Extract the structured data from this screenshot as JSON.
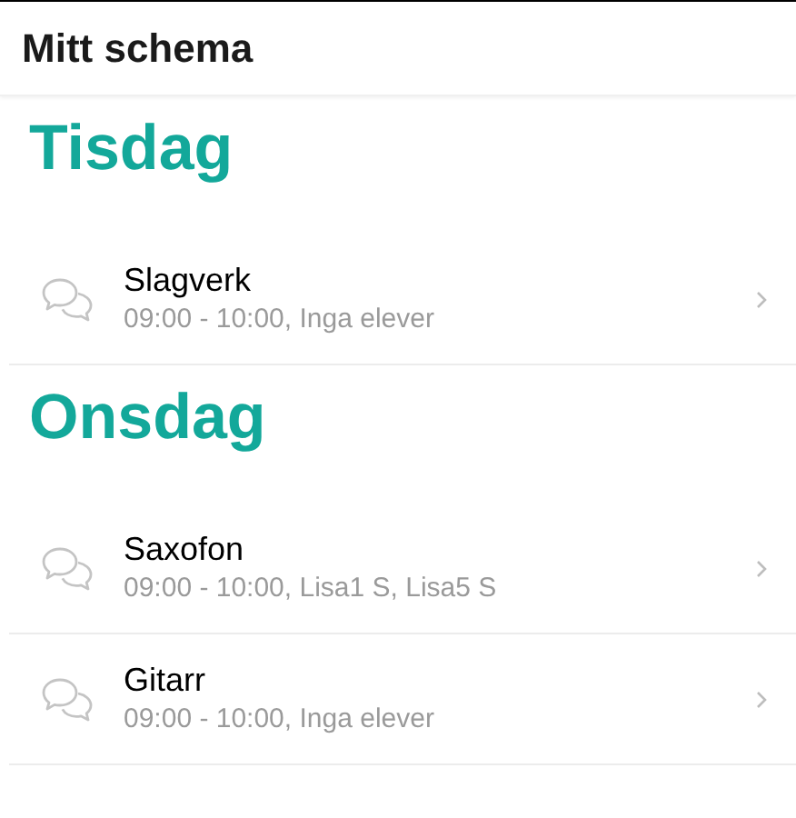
{
  "header": {
    "title": "Mitt schema"
  },
  "days": [
    {
      "name": "Tisdag",
      "lessons": [
        {
          "title": "Slagverk",
          "details": "09:00 - 10:00, Inga elever"
        }
      ]
    },
    {
      "name": "Onsdag",
      "lessons": [
        {
          "title": "Saxofon",
          "details": "09:00 - 10:00, Lisa1 S, Lisa5 S"
        },
        {
          "title": "Gitarr",
          "details": "09:00 - 10:00, Inga elever"
        }
      ]
    }
  ]
}
